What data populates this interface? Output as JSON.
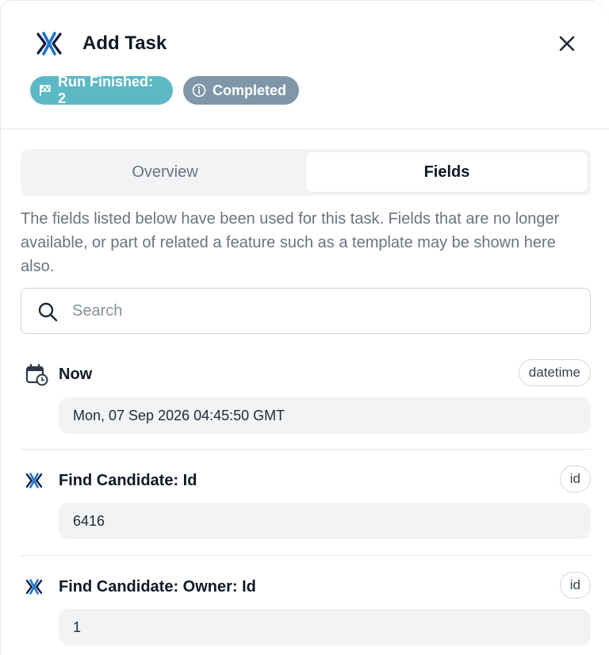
{
  "header": {
    "title": "Add Task",
    "logo_icon": "brand-x-logo",
    "close_icon": "close-icon",
    "badges": [
      {
        "label": "Run Finished: 2",
        "icon": "flag-icon",
        "color": "#5cb8c4"
      },
      {
        "label": "Completed",
        "icon": "info-icon",
        "color": "#7f97a8"
      }
    ]
  },
  "tabs": [
    {
      "label": "Overview",
      "active": false
    },
    {
      "label": "Fields",
      "active": true
    }
  ],
  "description": "The fields listed below have been used for this task. Fields that are no longer available, or part of related a feature such as a template may be shown here also.",
  "search": {
    "placeholder": "Search",
    "value": ""
  },
  "fields": [
    {
      "name": "Now",
      "type": "datetime",
      "value": "Mon, 07 Sep 2026 04:45:50 GMT",
      "icon": "calendar-clock-icon"
    },
    {
      "name": "Find Candidate: Id",
      "type": "id",
      "value": "6416",
      "icon": "brand-x-icon"
    },
    {
      "name": "Find Candidate: Owner: Id",
      "type": "id",
      "value": "1",
      "icon": "brand-x-icon"
    }
  ],
  "colors": {
    "accent": "#1e73c8",
    "dark": "#0d1b3e"
  }
}
